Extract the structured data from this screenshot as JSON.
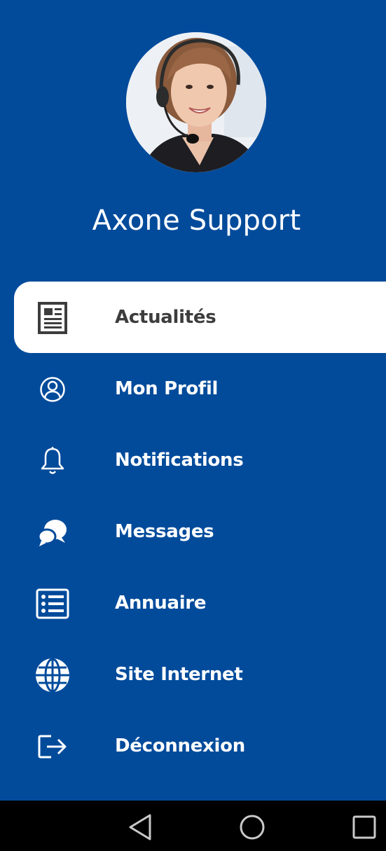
{
  "profile": {
    "name": "Axone Support",
    "avatar": "support-agent-photo"
  },
  "menu": {
    "items": [
      {
        "label": "Actualités",
        "icon": "newspaper-icon",
        "active": true
      },
      {
        "label": "Mon Profil",
        "icon": "user-circle-icon",
        "active": false
      },
      {
        "label": "Notifications",
        "icon": "bell-icon",
        "active": false
      },
      {
        "label": "Messages",
        "icon": "chat-bubbles-icon",
        "active": false
      },
      {
        "label": "Annuaire",
        "icon": "list-icon",
        "active": false
      },
      {
        "label": "Site Internet",
        "icon": "globe-icon",
        "active": false
      },
      {
        "label": "Déconnexion",
        "icon": "logout-icon",
        "active": false
      }
    ]
  },
  "navbar": {
    "buttons": [
      "back-triangle-icon",
      "home-circle-icon",
      "recents-square-icon"
    ]
  },
  "colors": {
    "primary": "#024b9b",
    "active_bg": "#ffffff",
    "active_text": "#3d3d3d",
    "text": "#ffffff",
    "navbar": "#000000"
  }
}
